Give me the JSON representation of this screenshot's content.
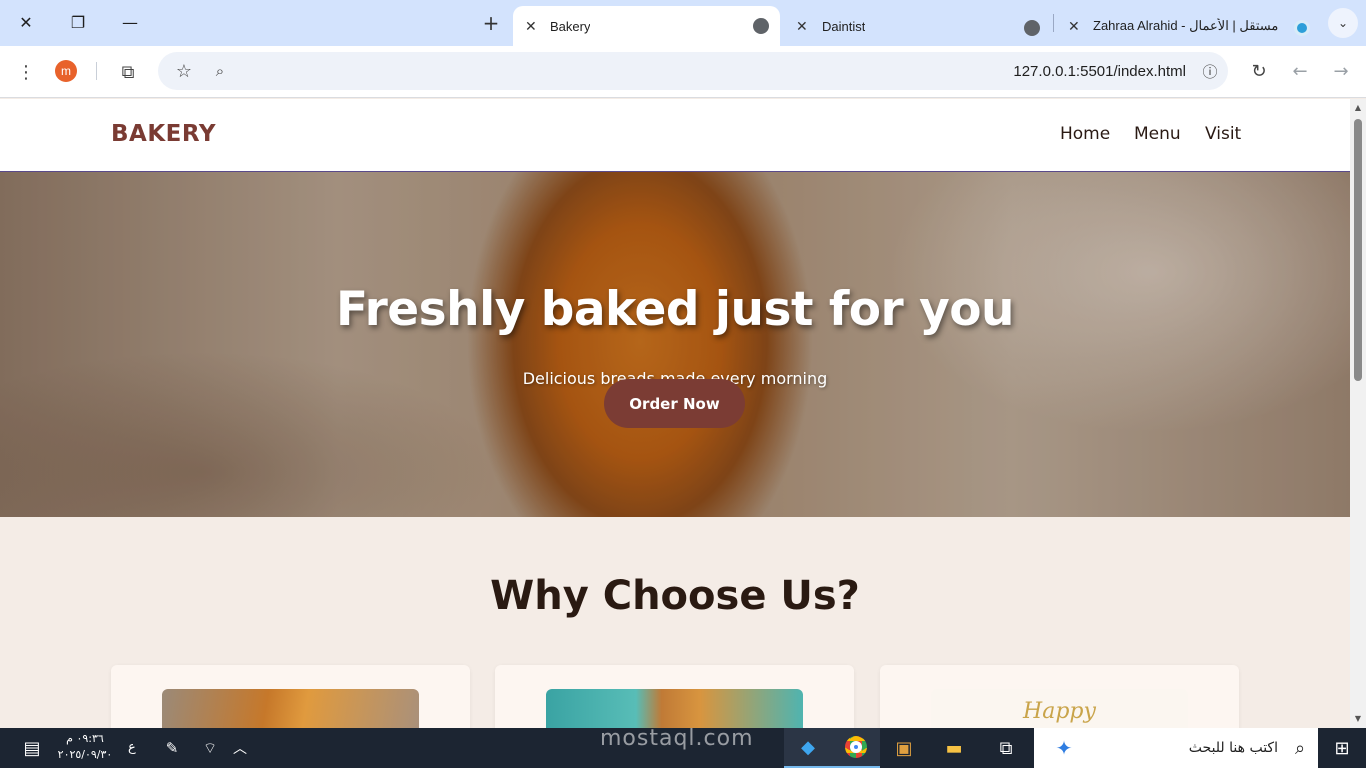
{
  "browser": {
    "tabs": [
      {
        "label": "Bakery",
        "active": true
      },
      {
        "label": "Daintist",
        "active": false
      },
      {
        "label": "Zahraa Alrahid - مستقل | ‫الأعمال",
        "active": false
      }
    ],
    "url": "127.0.0.1:5501/index.html",
    "profile_initial": "m"
  },
  "site": {
    "logo": "BAKERY",
    "nav": [
      "Home",
      "Menu",
      "Visit"
    ],
    "hero": {
      "title": "Freshly baked just for you",
      "subtitle": "Delicious breads made every morning",
      "cta": "Order Now"
    },
    "section_title": "Why Choose Us?",
    "card3_image_text": "Happy"
  },
  "watermark": "mostaql.com",
  "taskbar": {
    "search_placeholder": "اكتب هنا للبحث",
    "time": "٠٩:٣٦ م",
    "date": "٢٠٢٥/٠٩/٣٠",
    "lang": "ع"
  },
  "colors": {
    "brand": "#7a3b33",
    "cta_bg": "#7b3c34",
    "page_bg": "#f4ece6"
  }
}
